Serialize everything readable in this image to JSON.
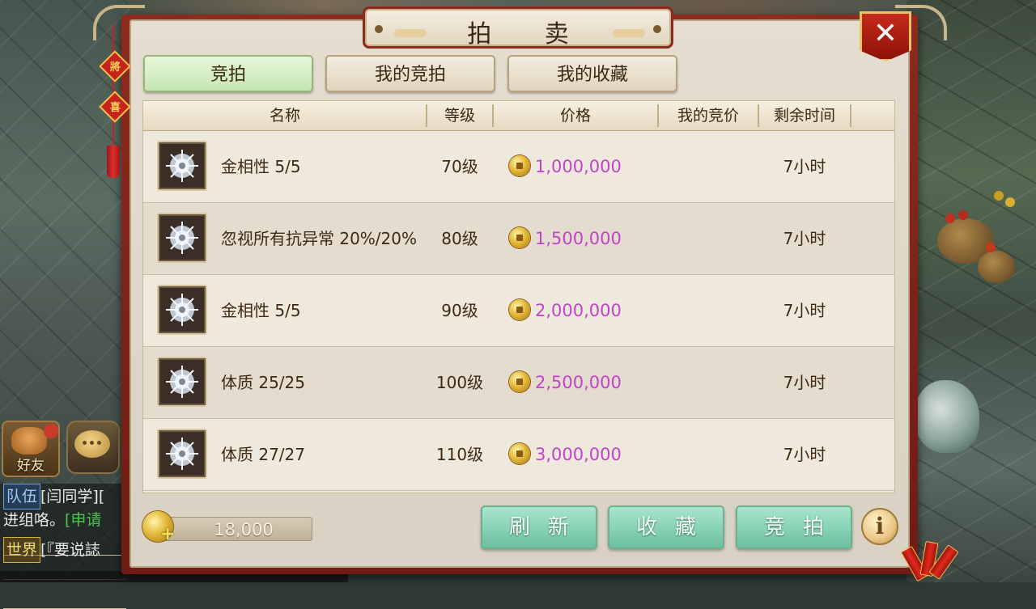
{
  "title": "拍 卖",
  "close_label": "✕",
  "tabs": [
    {
      "label": "竞拍",
      "active": true
    },
    {
      "label": "我的竞拍",
      "active": false
    },
    {
      "label": "我的收藏",
      "active": false
    }
  ],
  "columns": [
    "名称",
    "等级",
    "价格",
    "我的竞价",
    "剩余时间"
  ],
  "rows": [
    {
      "icon": "spirit-crystal-icon",
      "name": "金相性 5/5",
      "level": "70级",
      "price": "1,000,000",
      "my_bid": "",
      "remaining": "7小时"
    },
    {
      "icon": "spirit-crystal-icon",
      "name": "忽视所有抗异常 20%/20%",
      "level": "80级",
      "price": "1,500,000",
      "my_bid": "",
      "remaining": "7小时"
    },
    {
      "icon": "spirit-crystal-icon",
      "name": "金相性 5/5",
      "level": "90级",
      "price": "2,000,000",
      "my_bid": "",
      "remaining": "7小时"
    },
    {
      "icon": "spirit-crystal-icon",
      "name": "体质 25/25",
      "level": "100级",
      "price": "2,500,000",
      "my_bid": "",
      "remaining": "7小时"
    },
    {
      "icon": "spirit-crystal-icon",
      "name": "体质 27/27",
      "level": "110级",
      "price": "3,000,000",
      "my_bid": "",
      "remaining": "7小时"
    }
  ],
  "balance": "18,000",
  "buttons": {
    "refresh": "刷新",
    "favorite": "收藏",
    "bid": "竞拍"
  },
  "info_label": "i",
  "hud": {
    "friends_label": "好友"
  },
  "chat": {
    "line1_tag": "队伍",
    "line1_text": "[闫同学][",
    "line2_text": "进组咯。",
    "line2_green": "[申请",
    "line3_tag": "世界",
    "line3_text": "[『要说誌"
  },
  "ornament_chars": [
    "將",
    "喜"
  ],
  "colors": {
    "price": "#c244c8",
    "panel_frame": "#8e2a1e",
    "active_tab": "#c6e6b4",
    "button": "#6cc0a0"
  }
}
